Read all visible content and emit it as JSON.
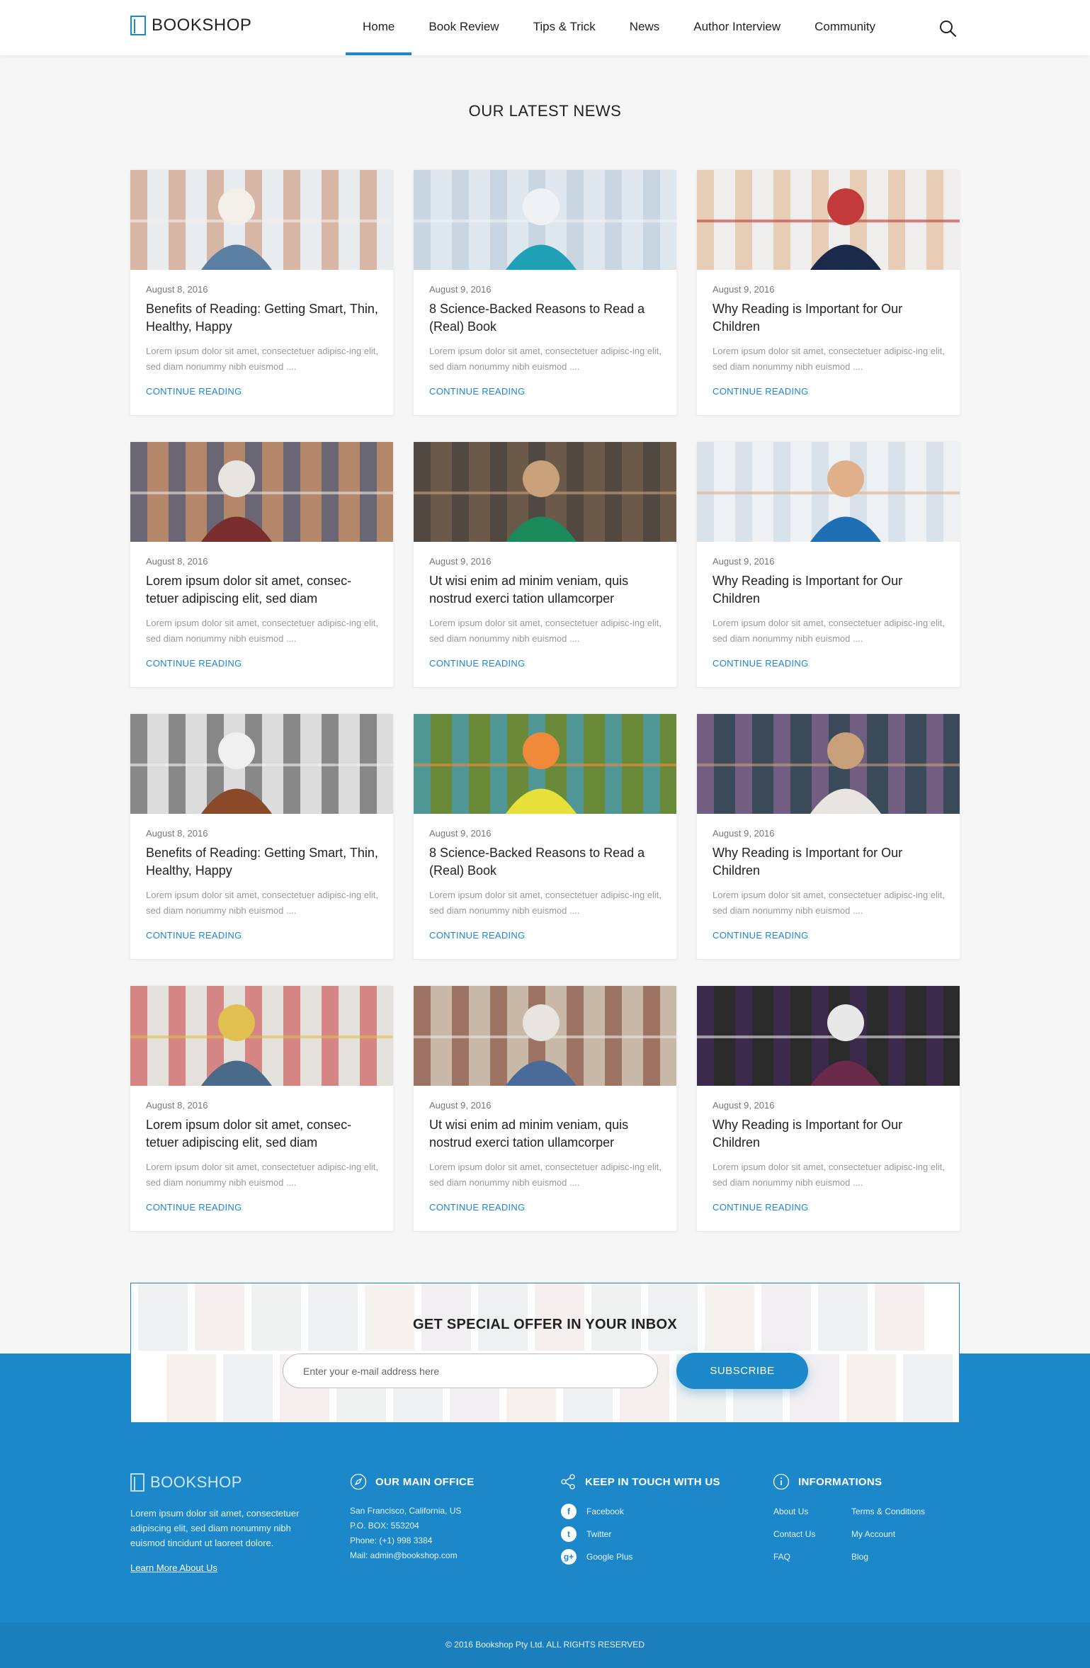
{
  "header": {
    "logo_text": "BOOKSHOP",
    "nav": [
      {
        "label": "Home"
      },
      {
        "label": "Book Review"
      },
      {
        "label": "Tips & Trick"
      },
      {
        "label": "News"
      },
      {
        "label": "Author Interview"
      },
      {
        "label": "Community"
      }
    ],
    "active_index": 0
  },
  "main": {
    "title": "OUR LATEST NEWS",
    "cards": [
      {
        "date": "August 8, 2016",
        "title": "Benefits of Reading: Getting Smart, Thin, Healthy, Happy",
        "excerpt": "Lorem ipsum dolor sit amet, consectetuer adipisc-ing elit, sed diam nonummy nibh euismod ....",
        "link": "CONTINUE READING"
      },
      {
        "date": "August 9, 2016",
        "title": "8 Science-Backed Reasons to Read a (Real) Book",
        "excerpt": "Lorem ipsum dolor sit amet, consectetuer adipisc-ing elit, sed diam nonummy nibh euismod ....",
        "link": "CONTINUE READING"
      },
      {
        "date": "August 9, 2016",
        "title": "Why Reading is Important for Our Children",
        "excerpt": "Lorem ipsum dolor sit amet, consectetuer adipisc-ing elit, sed diam nonummy nibh euismod ....",
        "link": "CONTINUE READING"
      },
      {
        "date": "August 8, 2016",
        "title": "Lorem ipsum dolor sit amet, consec-tetuer adipiscing elit, sed diam",
        "excerpt": "Lorem ipsum dolor sit amet, consectetuer adipisc-ing elit, sed diam nonummy nibh euismod ....",
        "link": "CONTINUE READING"
      },
      {
        "date": "August 9, 2016",
        "title": "Ut wisi enim ad minim veniam, quis nostrud exerci tation ullamcorper",
        "excerpt": "Lorem ipsum dolor sit amet, consectetuer adipisc-ing elit, sed diam nonummy nibh euismod ....",
        "link": "CONTINUE READING"
      },
      {
        "date": "August 9, 2016",
        "title": "Why Reading is Important for Our Children",
        "excerpt": "Lorem ipsum dolor sit amet, consectetuer adipisc-ing elit, sed diam nonummy nibh euismod ....",
        "link": "CONTINUE READING"
      },
      {
        "date": "August 8, 2016",
        "title": "Benefits of Reading: Getting Smart, Thin, Healthy, Happy",
        "excerpt": "Lorem ipsum dolor sit amet, consectetuer adipisc-ing elit, sed diam nonummy nibh euismod ....",
        "link": "CONTINUE READING"
      },
      {
        "date": "August 9, 2016",
        "title": "8 Science-Backed Reasons to Read a (Real) Book",
        "excerpt": "Lorem ipsum dolor sit amet, consectetuer adipisc-ing elit, sed diam nonummy nibh euismod ....",
        "link": "CONTINUE READING"
      },
      {
        "date": "August 9, 2016",
        "title": "Why Reading is Important for Our Children",
        "excerpt": "Lorem ipsum dolor sit amet, consectetuer adipisc-ing elit, sed diam nonummy nibh euismod ....",
        "link": "CONTINUE READING"
      },
      {
        "date": "August 8, 2016",
        "title": "Lorem ipsum dolor sit amet, consec-tetuer adipiscing elit, sed diam",
        "excerpt": "Lorem ipsum dolor sit amet, consectetuer adipisc-ing elit, sed diam nonummy nibh euismod ....",
        "link": "CONTINUE READING"
      },
      {
        "date": "August 9, 2016",
        "title": "Ut wisi enim ad minim veniam, quis nostrud exerci tation ullamcorper",
        "excerpt": "Lorem ipsum dolor sit amet, consectetuer adipisc-ing elit, sed diam nonummy nibh euismod ....",
        "link": "CONTINUE READING"
      },
      {
        "date": "August 9, 2016",
        "title": "Why Reading is Important for Our Children",
        "excerpt": "Lorem ipsum dolor sit amet, consectetuer adipisc-ing elit, sed diam nonummy nibh euismod ....",
        "link": "CONTINUE READING"
      }
    ]
  },
  "newsletter": {
    "title": "GET SPECIAL OFFER IN YOUR INBOX",
    "placeholder": "Enter your e-mail address here",
    "button": "SUBSCRIBE"
  },
  "footer": {
    "logo_text": "BOOKSHOP",
    "about": "Lorem ipsum dolor sit amet, consectetuer adipiscing elit, sed diam nonummy nibh euismod tincidunt ut laoreet dolore.",
    "learn_more": "Learn More About Us",
    "office": {
      "title": "OUR MAIN OFFICE",
      "address": "San Francisco, California, US",
      "pobox": "P.O. BOX: 553204",
      "phone": "Phone: (+1) 998 3384",
      "mail": "Mail: admin@bookshop.com"
    },
    "social": {
      "title": "KEEP IN TOUCH WITH US",
      "items": [
        {
          "label": "Facebook",
          "icon": "facebook-icon"
        },
        {
          "label": "Twitter",
          "icon": "twitter-icon"
        },
        {
          "label": "Google Plus",
          "icon": "google-plus-icon"
        }
      ]
    },
    "info": {
      "title": "INFORMATIONS",
      "links": [
        "About Us",
        "Terms & Conditions",
        "Contact Us",
        "My Account",
        "FAQ",
        "Blog"
      ]
    },
    "copyright": "© 2016 Bookshop Pty Ltd. ALL RIGHTS RESERVED"
  },
  "colors": {
    "accent": "#1c88c9",
    "footer_dark": "#1a7fbc",
    "page_bg": "#f6f6f7"
  }
}
